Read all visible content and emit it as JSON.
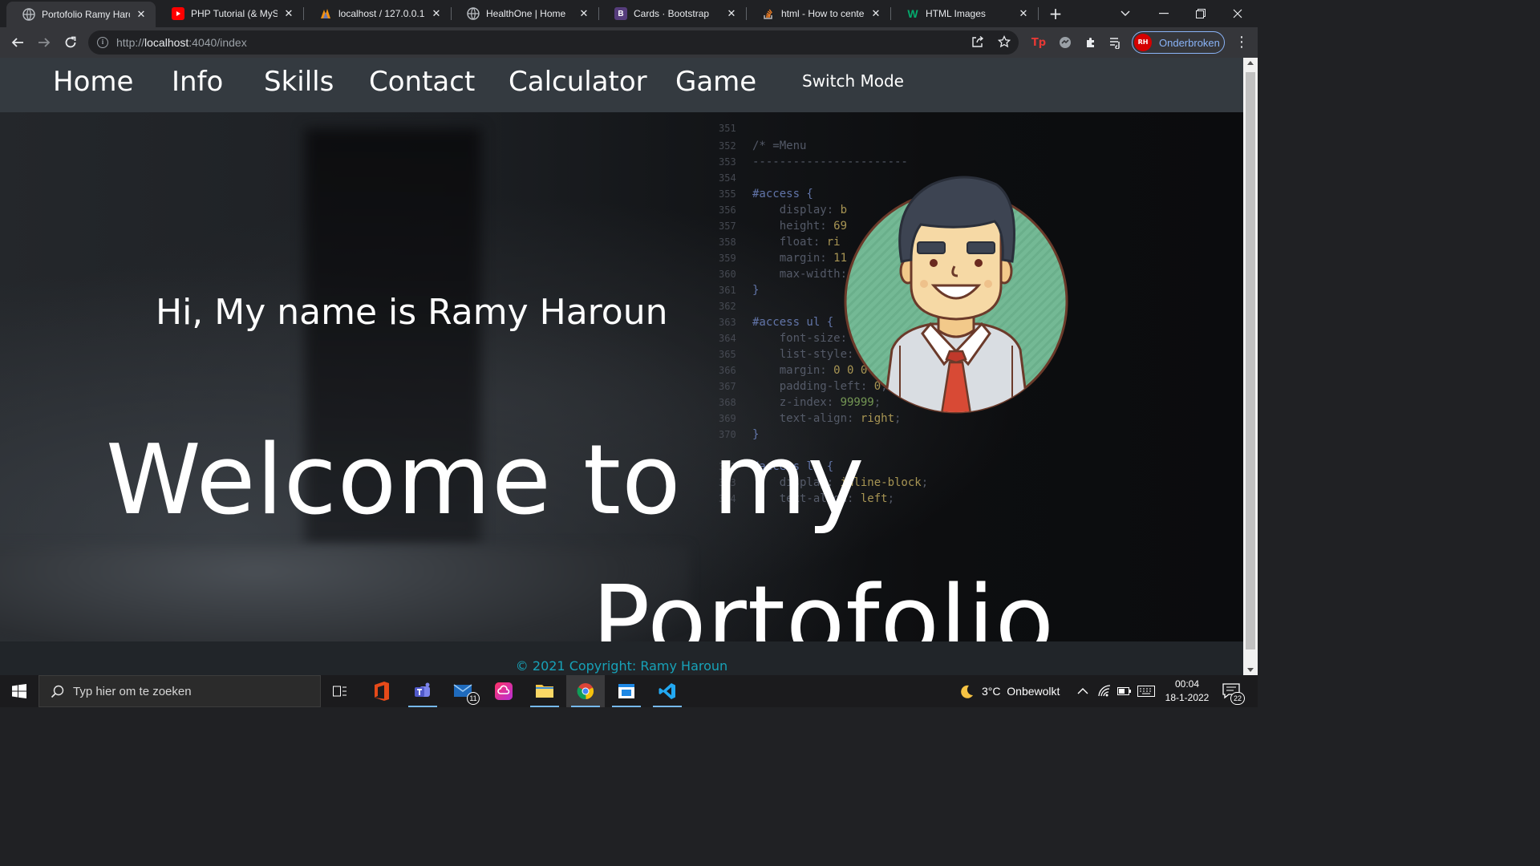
{
  "browser": {
    "tabs": [
      {
        "title": "Portofolio Ramy Haroun",
        "favicon": "globe-icon",
        "active": true
      },
      {
        "title": "PHP Tutorial (& MySQL",
        "favicon": "youtube-icon",
        "active": false
      },
      {
        "title": "localhost / 127.0.0.1 /",
        "favicon": "phpmyadmin-icon",
        "active": false
      },
      {
        "title": "HealthOne | Home",
        "favicon": "globe-icon",
        "active": false
      },
      {
        "title": "Cards · Bootstrap",
        "favicon": "bootstrap-icon",
        "active": false
      },
      {
        "title": "html - How to center",
        "favicon": "stackoverflow-icon",
        "active": false
      },
      {
        "title": "HTML Images",
        "favicon": "w3schools-icon",
        "active": false
      }
    ],
    "url_prefix": "http://",
    "url_host": "localhost",
    "url_rest": ":4040/index",
    "profile_name": "Onderbroken",
    "profile_initials": "RH",
    "colors": {
      "accent": "#8ab4f8",
      "profile": "#d50000"
    }
  },
  "page": {
    "nav": {
      "links": [
        "Home",
        "Info",
        "Skills",
        "Contact",
        "Calculator",
        "Game"
      ],
      "switch_mode": "Switch Mode"
    },
    "hero": {
      "greeting": "Hi, My name is Ramy Haroun",
      "welcome_line1": "Welcome to my",
      "welcome_line2": "Portofolio"
    },
    "footer": {
      "copyright": "© 2021 Copyright: Ramy Haroun"
    },
    "colors": {
      "navbar": "#343a40",
      "footer": "#212529",
      "footer_text": "#17a2b8"
    }
  },
  "taskbar": {
    "search_placeholder": "Typ hier om te zoeken",
    "mail_badge": "11",
    "weather": "3°C  Onbewolkt",
    "time": "00:04",
    "date": "18-1-2022",
    "notification_count": "22"
  }
}
